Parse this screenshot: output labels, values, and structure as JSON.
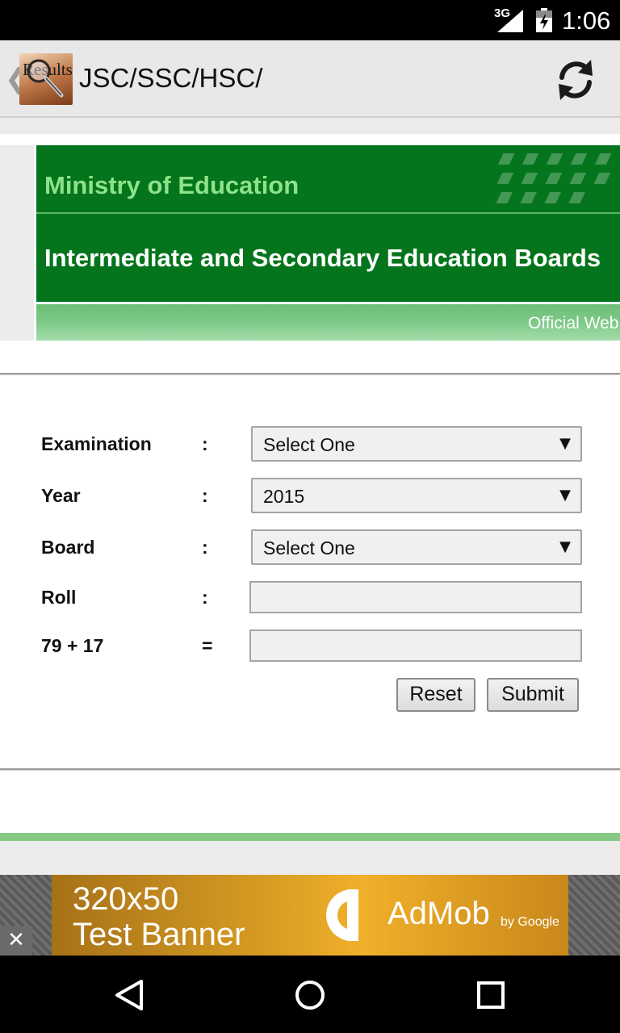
{
  "status_bar": {
    "network": "3G",
    "time": "1:06"
  },
  "action_bar": {
    "back_glyph": "❮",
    "icon_label": "Results",
    "title": "JSC/SSC/HSC/",
    "refresh_icon": "refresh-icon"
  },
  "banner": {
    "ministry": "Ministry of Education",
    "boards": "Intermediate and Secondary Education Boards",
    "official": "Official Web"
  },
  "form": {
    "fields": [
      {
        "label": "Examination",
        "separator": ":",
        "type": "select",
        "value": "Select One"
      },
      {
        "label": "Year",
        "separator": ":",
        "type": "select",
        "value": "2015"
      },
      {
        "label": "Board",
        "separator": ":",
        "type": "select",
        "value": "Select One"
      },
      {
        "label": "Roll",
        "separator": ":",
        "type": "input",
        "value": ""
      },
      {
        "label": "79 + 17",
        "separator": "=",
        "type": "input",
        "value": ""
      }
    ],
    "select_arrow": "▼",
    "reset_label": "Reset",
    "submit_label": "Submit"
  },
  "ad": {
    "size_text": "320x50",
    "test_text": "Test Banner",
    "brand": "AdMob",
    "by": "by Google",
    "close_glyph": "✕"
  },
  "colors": {
    "banner_green": "#04751c",
    "ministry_text": "#8ee28a",
    "accent_strip": "#86c985"
  }
}
